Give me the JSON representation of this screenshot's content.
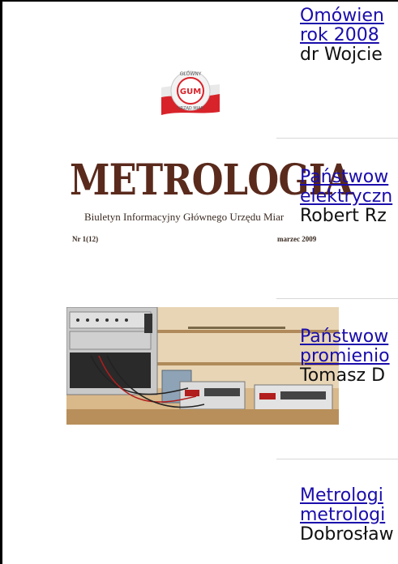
{
  "cover": {
    "logo_text_top": "GŁÓWNY",
    "logo_text_center": "GUM",
    "logo_text_bottom": "URZĄD MIAR",
    "title": "METROLOGIA",
    "subtitle": "Biuletyn Informacyjny Głównego Urzędu Miar",
    "issue_number": "Nr 1(12)",
    "issue_date": "marzec 2009"
  },
  "articles": [
    {
      "title_line1": "Omówien",
      "title_line2": "rok 2008",
      "author": "dr Wojcie"
    },
    {
      "title_line1": "Państwow",
      "title_line2": "elektryczn",
      "author": "Robert Rz"
    },
    {
      "title_line1": "Państwow",
      "title_line2": "promienio",
      "author": "Tomasz D"
    },
    {
      "title_line1": "Metrologi",
      "title_line2": "metrologi",
      "author": "Dobrosław"
    }
  ],
  "colors": {
    "title_brown": "#5a2a1c",
    "link_blue": "#1a0dab",
    "flag_red": "#d8232a"
  }
}
